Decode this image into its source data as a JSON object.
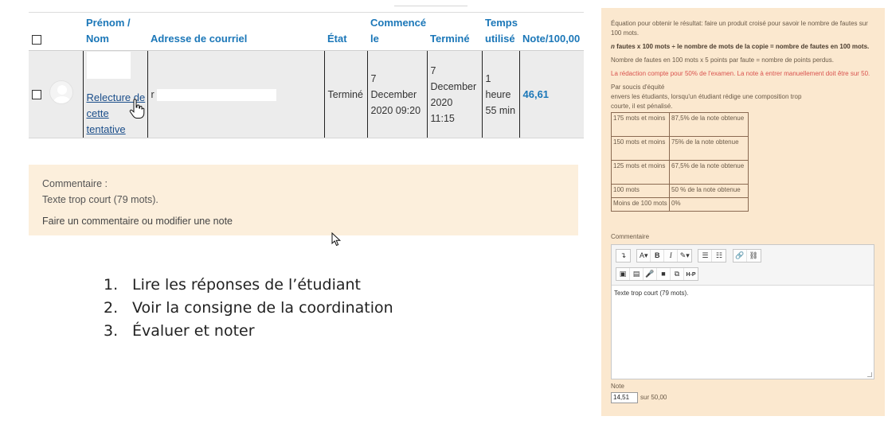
{
  "table": {
    "headers": {
      "name_line1": "Prénom /",
      "name_line2": "Nom",
      "email": "Adresse de courriel",
      "state": "État",
      "started_line1": "Commencé",
      "started_line2": "le",
      "finished": "Terminé",
      "time_line1": "Temps",
      "time_line2": "utilisé",
      "grade": "Note/100,00"
    },
    "row": {
      "review_line1": "Relecture de",
      "review_line2": "cette",
      "review_line3": "tentative",
      "email_prefix": "r",
      "state": "Terminé",
      "started": [
        "7",
        "December",
        "2020 09:20"
      ],
      "finished": [
        "7",
        "December",
        "2020",
        "11:15"
      ],
      "time": [
        "1",
        "heure",
        "55 min"
      ],
      "grade": "46,61"
    }
  },
  "comment": {
    "label": "Commentaire :",
    "text": "Texte trop court (79 mots).",
    "edit_link": "Faire un commentaire ou modifier une note"
  },
  "steps": [
    {
      "num": "1.",
      "text": "Lire les réponses de l’étudiant"
    },
    {
      "num": "2.",
      "text": "Voir la consigne de la coordination"
    },
    {
      "num": "3.",
      "text": "Évaluer et noter"
    }
  ],
  "panel": {
    "line1": "Équation pour obtenir le résultat: faire un produit croisé pour savoir le nombre de fautes sur 100 mots.",
    "bold_prefix": "n",
    "bold_line": " fautes x 100 mots ÷ le nombre de mots de la copie = nombre de fautes en 100 mots.",
    "line3": "Nombre de fautes en 100 mots x 5 points par faute = nombre de points perdus.",
    "red_line": "La rédaction compte pour 50% de l'examen. La note à entrer manuellement doit être sur 50.",
    "fair1": "Par soucis d'équité",
    "fair2": "envers les étudiants, lorsqu'un étudiant rédige une composition trop",
    "fair3": "courte, il est pénalisé.",
    "rules": [
      {
        "words": "175 mots et moins",
        "grade": "87,5% de la note obtenue"
      },
      {
        "words": "150 mots et moins",
        "grade": "75% de la note obtenue"
      },
      {
        "words": "125 mots et moins",
        "grade": "67,5% de la note obtenue"
      },
      {
        "words": "100 mots",
        "grade": "50 %  de la note obtenue"
      },
      {
        "words": "Moins de 100 mots",
        "grade": "0%"
      }
    ],
    "comment_label": "Commentaire",
    "editor_text": "Texte trop court (79 mots).",
    "note_label": "Note",
    "note_value": "14,51",
    "note_suffix": "sur 50,00",
    "toolbar": {
      "undo": "↴",
      "font": "A▾",
      "bold": "B",
      "italic": "I",
      "paint": "✎▾",
      "bullets": "☰",
      "numbers": "☷",
      "link": "🔗",
      "unlink": "⛓",
      "image": "▣",
      "media": "▤",
      "mic": "🎤",
      "video": "■",
      "copy": "⧉",
      "h5p": "H-P"
    }
  }
}
